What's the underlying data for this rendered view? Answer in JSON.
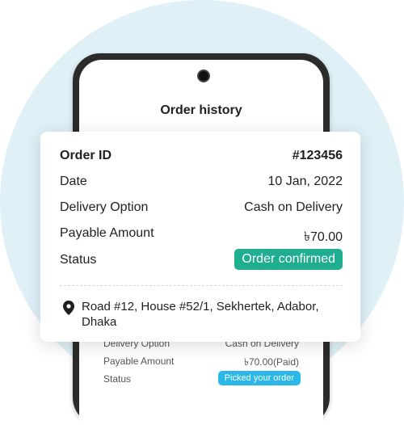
{
  "screen": {
    "title": "Order history"
  },
  "background_list": [
    {
      "label": "Delivery Option",
      "value": "Cash on Delivery"
    },
    {
      "label": "Payable Amount",
      "value": "৳70.00(Paid)"
    },
    {
      "label": "Status",
      "badge": "Picked your order"
    }
  ],
  "card": {
    "order_id_label": "Order ID",
    "order_id_value": "#123456",
    "date_label": "Date",
    "date_value": "10 Jan, 2022",
    "delivery_label": "Delivery Option",
    "delivery_value": "Cash on Delivery",
    "amount_label": "Payable Amount",
    "amount_value": "৳70.00",
    "status_label": "Status",
    "status_value": "Order confirmed",
    "address_icon": "location-pin-icon",
    "address": "Road #12, House #52/1, Sekhertek, Adabor, Dhaka"
  },
  "colors": {
    "status_confirmed": "#1fae8f",
    "status_picked": "#2ab8e8",
    "background_circle": "#dff1f7"
  }
}
